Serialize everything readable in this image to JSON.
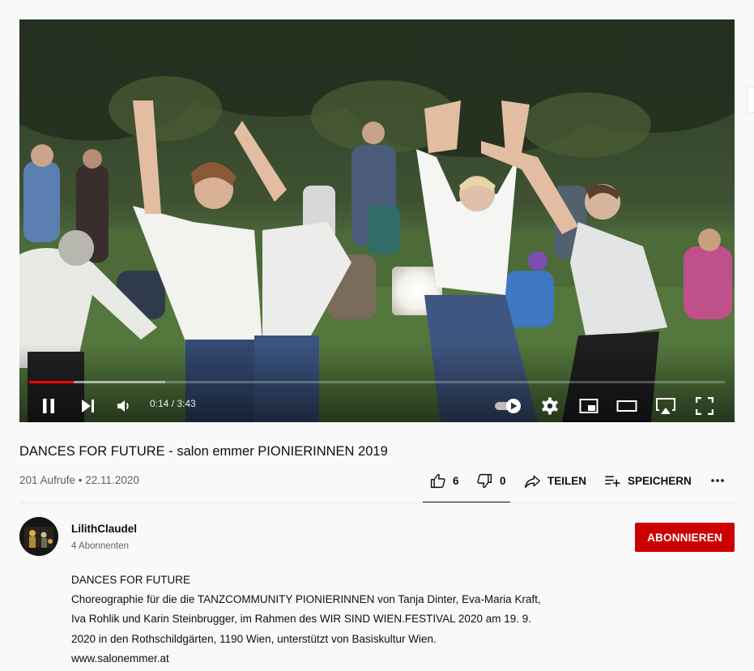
{
  "player": {
    "time_display": "0:14 / 3:43",
    "progress_fraction": 0.064,
    "buffered_fraction": 0.195,
    "progress_color": "#ff0000"
  },
  "video": {
    "title": "DANCES FOR FUTURE - salon emmer PIONIERINNEN 2019",
    "meta": "201 Aufrufe • 22.11.2020"
  },
  "actions": {
    "like_count": "6",
    "dislike_count": "0",
    "share_label": "TEILEN",
    "save_label": "SPEICHERN",
    "more_label": "..."
  },
  "channel": {
    "name": "LilithClaudel",
    "subscribers": "4 Abonnenten",
    "subscribe_label": "ABONNIEREN",
    "subscribe_color": "#cc0000"
  },
  "description": {
    "lines": [
      "DANCES FOR FUTURE",
      "Choreographie für die die TANZCOMMUNITY PIONIERINNEN von Tanja Dinter, Eva-Maria Kraft,",
      "Iva Rohlik und Karin Steinbrugger, im Rahmen des WIR SIND WIEN.FESTIVAL 2020 am 19. 9.",
      "2020 in den Rothschildgärten, 1190 Wien, unterstützt von Basiskultur Wien.",
      "www.salonemmer.at"
    ]
  },
  "icons": {
    "play_pause": "pause-icon",
    "next": "next-icon",
    "volume": "volume-icon",
    "autoplay": "autoplay-toggle-icon",
    "settings": "gear-icon",
    "miniplayer": "miniplayer-icon",
    "theater": "theater-mode-icon",
    "cast": "cast-icon",
    "fullscreen": "fullscreen-icon",
    "like": "thumbs-up-icon",
    "dislike": "thumbs-down-icon",
    "share": "share-icon",
    "save": "playlist-add-icon",
    "more": "more-horiz-icon"
  }
}
